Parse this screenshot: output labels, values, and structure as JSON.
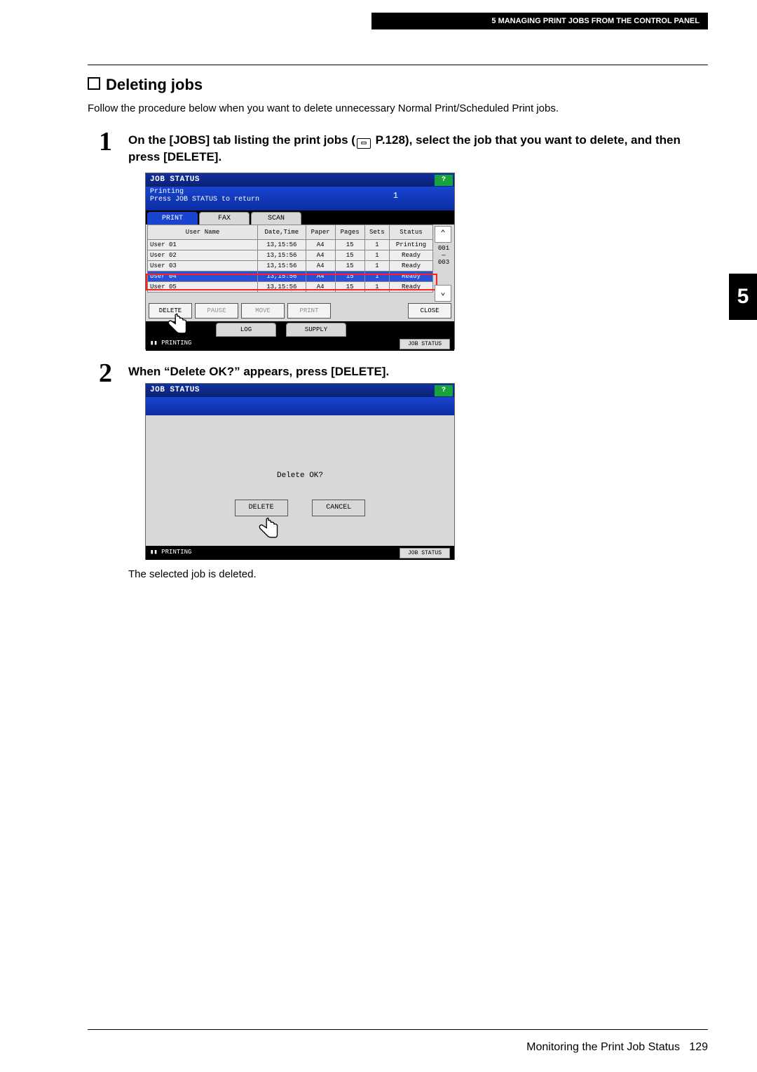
{
  "header": {
    "chapter_title": "5 MANAGING PRINT JOBS FROM THE CONTROL PANEL"
  },
  "chapter_tab": "5",
  "footer": {
    "text": "Monitoring the Print Job Status",
    "page": "129"
  },
  "section": {
    "title": "Deleting jobs"
  },
  "intro": "Follow the procedure below when you want to delete unnecessary Normal Print/Scheduled Print jobs.",
  "step1": {
    "num": "1",
    "text_a": "On the [JOBS] tab listing the print jobs (",
    "page_ref": " P.128",
    "text_b": "), select the job that you want to delete, and then press [DELETE]."
  },
  "step2": {
    "num": "2",
    "text": "When “Delete OK?” appears, press [DELETE]."
  },
  "result": "The selected job is deleted.",
  "panel1": {
    "title": "JOB STATUS",
    "help": "?",
    "sub_line1": "Printing",
    "sub_line2": "Press JOB STATUS to return",
    "count": "1",
    "tabs": {
      "print": "PRINT",
      "fax": "FAX",
      "scan": "SCAN"
    },
    "columns": {
      "user": "User Name",
      "dt": "Date,Time",
      "paper": "Paper",
      "pages": "Pages",
      "sets": "Sets",
      "status": "Status"
    },
    "rows": [
      {
        "user": "User 01",
        "dt": "13,15:56",
        "paper": "A4",
        "pages": "15",
        "sets": "1",
        "status": "Printing"
      },
      {
        "user": "User 02",
        "dt": "13,15:56",
        "paper": "A4",
        "pages": "15",
        "sets": "1",
        "status": "Ready"
      },
      {
        "user": "User 03",
        "dt": "13,15:56",
        "paper": "A4",
        "pages": "15",
        "sets": "1",
        "status": "Ready"
      },
      {
        "user": "User 04",
        "dt": "13,15:56",
        "paper": "A4",
        "pages": "15",
        "sets": "1",
        "status": "Ready"
      },
      {
        "user": "User 05",
        "dt": "13,15:56",
        "paper": "A4",
        "pages": "15",
        "sets": "1",
        "status": "Ready"
      }
    ],
    "scroll": {
      "page_cur": "001",
      "page_tot": "003",
      "up": "⌃",
      "down": "⌄"
    },
    "buttons": {
      "delete": "DELETE",
      "pause": "PAUSE",
      "move": "MOVE",
      "print": "PRINT",
      "close": "CLOSE"
    },
    "tabs2": {
      "log": "LOG",
      "supply": "SUPPLY"
    },
    "statusbar": {
      "left": "▮▮ PRINTING",
      "right": "JOB STATUS"
    }
  },
  "panel2": {
    "title": "JOB STATUS",
    "help": "?",
    "prompt": "Delete OK?",
    "delete": "DELETE",
    "cancel": "CANCEL",
    "statusbar": {
      "left": "▮▮ PRINTING",
      "right": "JOB STATUS"
    }
  }
}
